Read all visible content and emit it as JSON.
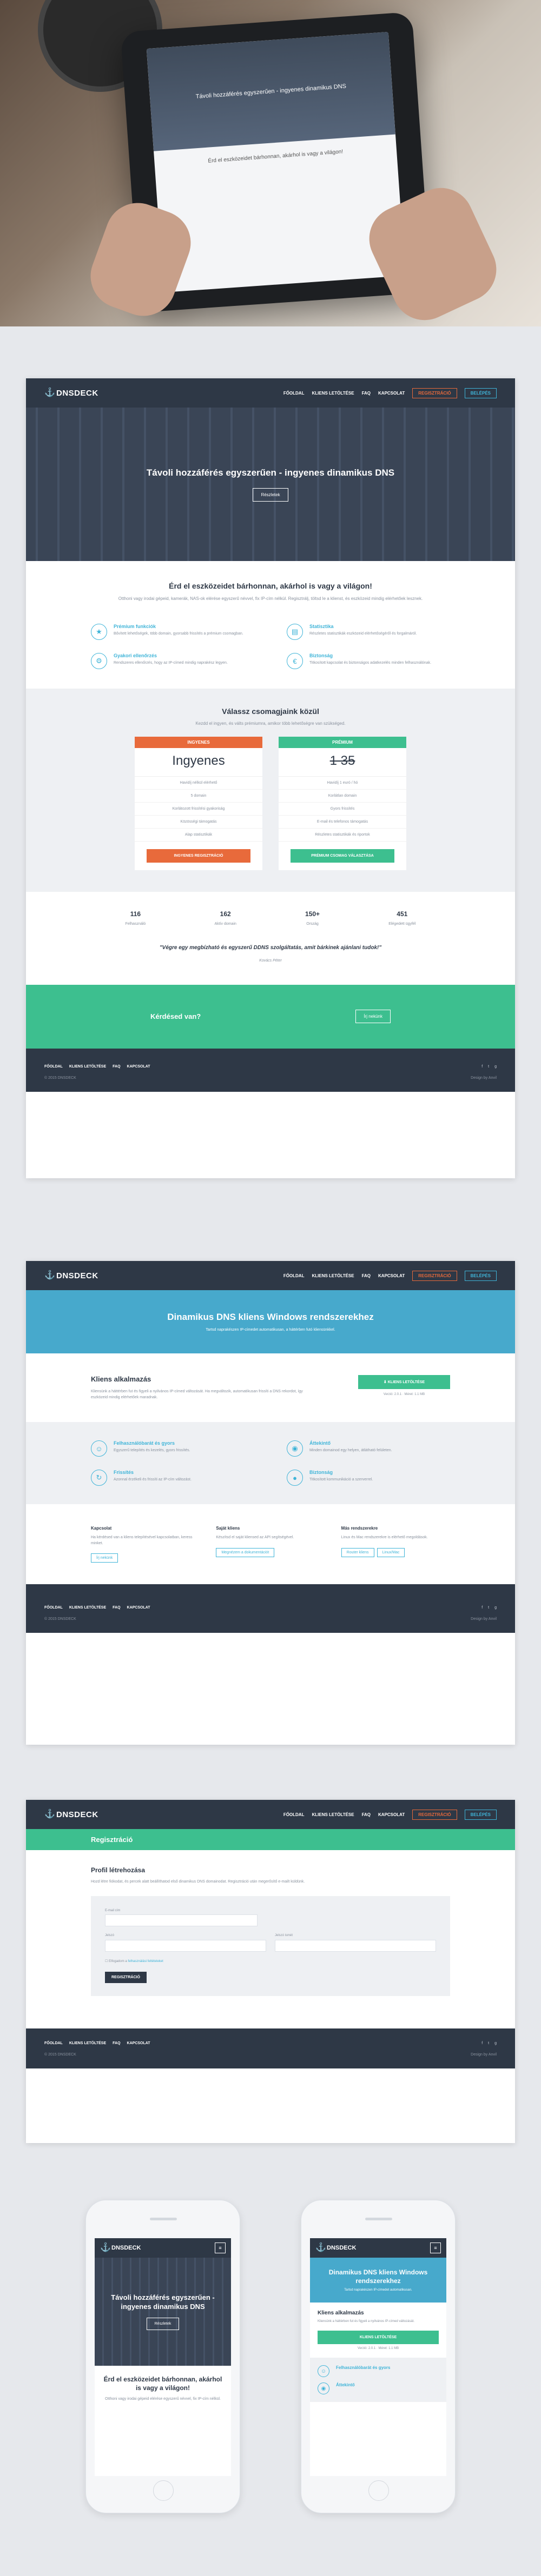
{
  "brand": {
    "name": "DNSDECK",
    "accent": "#3fb4d8",
    "dark": "#2e3846",
    "green": "#3dbf8f",
    "orange": "#e86a3b"
  },
  "nav": {
    "links": [
      "FŐOLDAL",
      "KLIENS LETÖLTÉSE",
      "FAQ",
      "KAPCSOLAT"
    ],
    "register": "REGISZTRÁCIÓ",
    "login": "BELÉPÉS"
  },
  "tablet": {
    "title": "Távoli hozzáférés egyszerűen - ingyenes dinamikus DNS",
    "tagline": "Érd el eszközeidet bárhonnan, akárhol is vagy a világon!"
  },
  "home": {
    "hero_title": "Távoli hozzáférés egyszerűen - ingyenes dinamikus DNS",
    "hero_button": "Részletek",
    "intro_title": "Érd el eszközeidet bárhonnan, akárhol is vagy a világon!",
    "intro_text": "Otthoni vagy irodai gépeid, kamerák, NAS-ok elérése egyszerű névvel, fix IP-cím nélkül. Regisztrálj, töltsd le a klienst, és eszközeid mindig elérhetőek lesznek.",
    "features": [
      {
        "icon": "star-icon",
        "title": "Prémium funkciók",
        "text": "Bővített lehetőségek, több domain, gyorsabb frissítés a prémium csomagban."
      },
      {
        "icon": "chart-icon",
        "title": "Statisztika",
        "text": "Részletes statisztikák eszközeid elérhetőségéről és forgalmáról."
      },
      {
        "icon": "gear-icon",
        "title": "Gyakori ellenőrzés",
        "text": "Rendszeres ellenőrzés, hogy az IP-címed mindig naprakész legyen."
      },
      {
        "icon": "euro-icon",
        "title": "Biztonság",
        "text": "Titkosított kapcsolat és biztonságos adatkezelés minden felhasználónak."
      }
    ],
    "pricing_title": "Válassz csomagjaink közül",
    "pricing_sub": "Kezdd el ingyen, és válts prémiumra, amikor több lehetőségre van szükséged.",
    "plans": [
      {
        "head": "INGYENES",
        "price": "Ingyenes",
        "strike": false,
        "items": [
          "Havidíj nélkül elérhető",
          "5 domain",
          "Korlátozott frissítési gyakoriság",
          "Közösségi támogatás",
          "Alap statisztikák"
        ],
        "button": "INGYENES REGISZTRÁCIÓ",
        "color": "#e86a3b"
      },
      {
        "head": "PRÉMIUM",
        "price": "1 35",
        "strike": true,
        "items": [
          "Havidíj 1 euró / hó",
          "Korlátlan domain",
          "Gyors frissítés",
          "E-mail és telefonos támogatás",
          "Részletes statisztikák és riportok"
        ],
        "button": "PRÉMIUM CSOMAG VÁLASZTÁSA",
        "color": "#3dbf8f"
      }
    ],
    "stats": [
      {
        "value": "116",
        "label": "Felhasználó"
      },
      {
        "value": "162",
        "label": "Aktív domain"
      },
      {
        "value": "150+",
        "label": "Ország"
      },
      {
        "value": "451",
        "label": "Elégedett ügyfél"
      }
    ],
    "quote": "\"Végre egy megbízható és egyszerű DDNS szolgáltatás, amit bárkinek ajánlani tudok!\"",
    "quote_author": "Kovács Péter",
    "cta_text": "Kérdésed van?",
    "cta_button": "Írj nekünk"
  },
  "footer": {
    "links": [
      "FŐOLDAL",
      "KLIENS LETÖLTÉSE",
      "FAQ",
      "KAPCSOLAT"
    ],
    "copyright": "© 2015 DNSDECK",
    "credit": "Design by Anvil"
  },
  "client_page": {
    "title": "Dinamikus DNS kliens Windows rendszerekhez",
    "subtitle": "Tartsd naprakészen IP-címedet automatikusan, a háttérben futó kliensünkkel.",
    "section_title": "Kliens alkalmazás",
    "section_text": "Kliensünk a háttérben fut és figyeli a nyilvános IP-címed változását. Ha megváltozik, automatikusan frissíti a DNS rekordot, így eszközeid mindig elérhetőek maradnak.",
    "download_button": "KLIENS LETÖLTÉSE",
    "version": "Verzió: 2.0.1",
    "size": "Méret: 1.1 MB",
    "features": [
      {
        "icon": "user-icon",
        "title": "Felhasználóbarát és gyors",
        "text": "Egyszerű telepítés és kezelés, gyors frissítés."
      },
      {
        "icon": "eye-icon",
        "title": "Áttekintő",
        "text": "Minden domainod egy helyen, átlátható felületen."
      },
      {
        "icon": "bolt-icon",
        "title": "Frissítés",
        "text": "Azonnal érzékeli és frissíti az IP-cím változást."
      },
      {
        "icon": "lock-icon",
        "title": "Biztonság",
        "text": "Titkosított kommunikáció a szerverrel."
      }
    ],
    "downloads": [
      {
        "title": "Kapcsolat",
        "text": "Ha kérdésed van a kliens telepítésével kapcsolatban, keress minket.",
        "buttons": [
          "Írj nekünk"
        ]
      },
      {
        "title": "Saját kliens",
        "text": "Készítsd el saját kliensed az API segítségével.",
        "buttons": [
          "Megnézem a dokumentációt"
        ]
      },
      {
        "title": "Más rendszerekre",
        "text": "Linux és Mac rendszerekre is elérhető megoldások.",
        "buttons": [
          "Router kliens",
          "Linux/Mac"
        ]
      }
    ]
  },
  "register_page": {
    "band": "Regisztráció",
    "title": "Profil létrehozása",
    "intro": "Hozd létre fiókodat, és percek alatt beállíthatod első dinamikus DNS domainodat. Regisztráció után megerősítő e-mailt küldünk.",
    "email_label": "E-mail cím",
    "pass_label": "Jelszó",
    "pass2_label": "Jelszó ismét",
    "terms_prefix": "Elfogadom a ",
    "terms_link": "felhasználási feltételeket",
    "submit": "REGISZTRÁCIÓ"
  },
  "mobile": {
    "home_title": "Távoli hozzáférés egyszerűen - ingyenes dinamikus DNS",
    "home_button": "Részletek",
    "home_tagline": "Érd el eszközeidet bárhonnan, akárhol is vagy a világon!",
    "home_text": "Otthoni vagy irodai gépeid elérése egyszerű névvel, fix IP-cím nélkül.",
    "client_title": "Dinamikus DNS kliens Windows rendszerekhez",
    "client_sub": "Tartsd naprakészen IP-címedet automatikusan.",
    "client_section": "Kliens alkalmazás",
    "client_text": "Kliensünk a háttérben fut és figyeli a nyilvános IP-címed változását.",
    "client_button": "KLIENS LETÖLTÉSE",
    "client_version": "Verzió: 2.0.1 · Méret: 1.1 MB",
    "client_feature": "Felhasználóbarát és gyors",
    "client_feature2": "Áttekintő"
  }
}
